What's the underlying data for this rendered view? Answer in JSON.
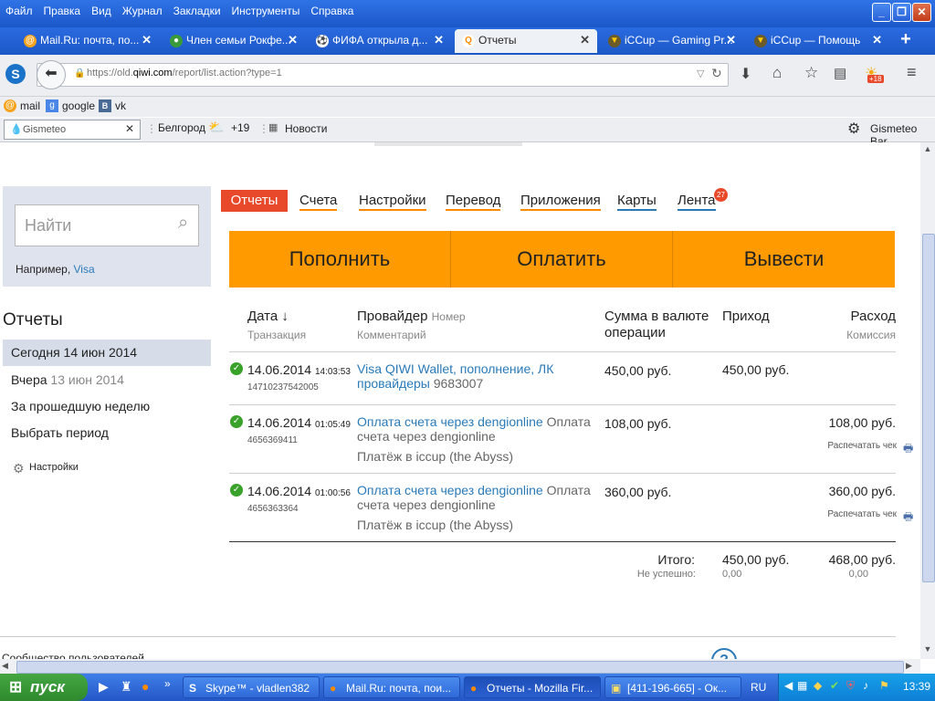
{
  "menu": [
    "Файл",
    "Правка",
    "Вид",
    "Журнал",
    "Закладки",
    "Инструменты",
    "Справка"
  ],
  "tabs": [
    {
      "label": "Mail.Ru: почта, по...",
      "icon": "@"
    },
    {
      "label": "Член семьи Рокфе...",
      "icon": "●"
    },
    {
      "label": "ФИФА открыла д...",
      "icon": "⚽"
    },
    {
      "label": "Отчеты",
      "icon": "Q"
    },
    {
      "label": "iCCup — Gaming Pr...",
      "icon": "▼"
    },
    {
      "label": "iCCup — Помощь",
      "icon": "▼"
    }
  ],
  "url": {
    "prefix": "https://old.",
    "domain": "qiwi.com",
    "rest": "/report/list.action?type=1"
  },
  "bookmarks": [
    "mail",
    "google",
    "vk"
  ],
  "gismeteo": {
    "search": "Gismeteo",
    "city": "Белгород",
    "temp": "+19",
    "news": "Новости",
    "bar": "Gismeteo Bar",
    "badge": "+18"
  },
  "sidebar": {
    "search_placeholder": "Найти",
    "example_prefix": "Например,",
    "example_link": "Visa",
    "reports_title": "Отчеты",
    "items": [
      {
        "label": "Сегодня 14 июн 2014",
        "extra": ""
      },
      {
        "label": "Вчера",
        "extra": "13 июн 2014"
      },
      {
        "label": "За прошедшую неделю",
        "extra": ""
      },
      {
        "label": "Выбрать период",
        "extra": ""
      }
    ],
    "settings": "Настройки"
  },
  "topnav": {
    "active": "Отчеты",
    "links": [
      "Счета",
      "Настройки",
      "Перевод",
      "Приложения",
      "Карты",
      "Лента"
    ],
    "badge": "27"
  },
  "actions": [
    "Пополнить",
    "Оплатить",
    "Вывести"
  ],
  "table": {
    "headers": {
      "date": "Дата ↓",
      "date_sub": "Транзакция",
      "provider": "Провайдер",
      "provider_num": "Номер",
      "provider_sub": "Комментарий",
      "amount": "Сумма в валюте операции",
      "income": "Приход",
      "expense": "Расход",
      "expense_sub": "Комиссия"
    },
    "rows": [
      {
        "date": "14.06.2014",
        "time": "14:03:53",
        "txn": "14710237542005",
        "provider": "Visa QIWI Wallet, пополнение, ЛК провайдеры",
        "number": "9683007",
        "comment": "",
        "amount": "450,00 руб.",
        "income": "450,00 руб.",
        "expense": "",
        "print": ""
      },
      {
        "date": "14.06.2014",
        "time": "01:05:49",
        "txn": "4656369411",
        "provider": "Оплата счета через dengionline",
        "number": "Оплата счета через dengionline",
        "comment": "Платёж в iccup (the Abyss)",
        "amount": "108,00 руб.",
        "income": "",
        "expense": "108,00 руб.",
        "print": "Распечатать чек"
      },
      {
        "date": "14.06.2014",
        "time": "01:00:56",
        "txn": "4656363364",
        "provider": "Оплата счета через dengionline",
        "number": "Оплата счета через dengionline",
        "comment": "Платёж в iccup (the Abyss)",
        "amount": "360,00 руб.",
        "income": "",
        "expense": "360,00 руб.",
        "print": "Распечатать чек"
      }
    ],
    "total_label": "Итого:",
    "total_income": "450,00 руб.",
    "total_expense": "468,00 руб.",
    "failed_label": "Не успешно:",
    "failed_income": "0,00",
    "failed_expense": "0,00"
  },
  "footer_cut": "Сообщество пользователей",
  "taskbar": {
    "start": "пуск",
    "tasks": [
      "Skype™ - vladlen382",
      "Mail.Ru: почта, пои...",
      "Отчеты - Mozilla Fir...",
      "[411-196-665] - Ок..."
    ],
    "lang": "RU",
    "clock": "13:39"
  }
}
